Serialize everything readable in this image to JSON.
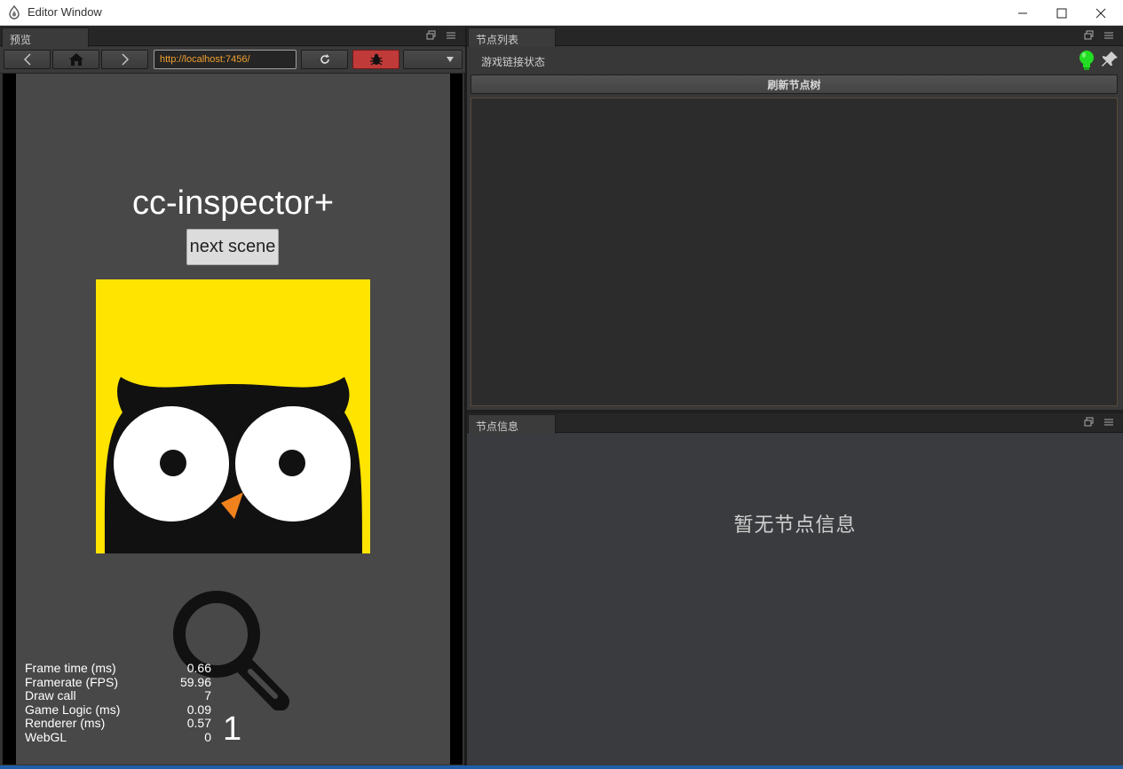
{
  "window": {
    "title": "Editor Window"
  },
  "preview": {
    "tab_label": "预览",
    "url": "http://localhost:7456/",
    "game": {
      "title": "cc-inspector+",
      "button_label": "next scene",
      "counter": "1",
      "stats": [
        {
          "label": "Frame time (ms)",
          "value": "0.66"
        },
        {
          "label": "Framerate (FPS)",
          "value": "59.96"
        },
        {
          "label": "Draw call",
          "value": "7"
        },
        {
          "label": "Game Logic (ms)",
          "value": "0.09"
        },
        {
          "label": "Renderer (ms)",
          "value": "0.57"
        },
        {
          "label": "WebGL",
          "value": "0"
        }
      ]
    }
  },
  "nodes": {
    "tab_label": "节点列表",
    "status_label": "游戏链接状态",
    "refresh_label": "刷新节点树",
    "status_color": "#22dd22"
  },
  "info": {
    "tab_label": "节点信息",
    "empty_text": "暂无节点信息"
  },
  "icons": [
    "app-icon",
    "minimize-icon",
    "maximize-icon",
    "close-icon",
    "back-icon",
    "home-icon",
    "forward-icon",
    "reload-icon",
    "bug-icon",
    "dropdown-icon",
    "popout-icon",
    "menu-icon",
    "lightbulb-icon",
    "pin-icon"
  ]
}
